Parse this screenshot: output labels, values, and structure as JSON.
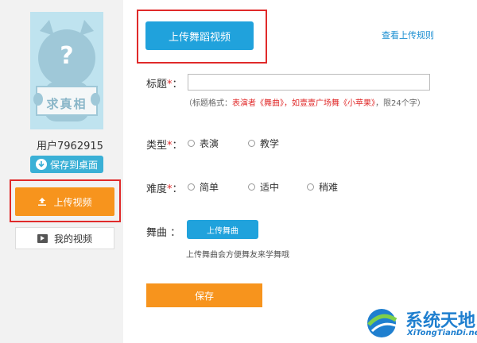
{
  "sidebar": {
    "avatar_caption": "求真相",
    "avatar_mark": "?",
    "username": "用户7962915",
    "save_desktop_label": "保存到桌面",
    "upload_video_label": "上传视频",
    "my_videos_label": "我的视频"
  },
  "main": {
    "upload_dance_label": "上传舞蹈视频",
    "rules_link": "查看上传规则",
    "title_label": "标题",
    "required_mark": "*",
    "colon": "：",
    "title_value": "",
    "hint": {
      "prefix": "（标题格式：",
      "red": "表演者《舞曲》，如壹壹广场舞《小苹果》",
      "suffix": "，限24个字）"
    },
    "type_label": "类型",
    "type_options": [
      "表演",
      "教学"
    ],
    "difficulty_label": "难度",
    "difficulty_options": [
      "简单",
      "适中",
      "稍难"
    ],
    "song_label": "舞曲 ：",
    "upload_song_label": "上传舞曲",
    "song_note": "上传舞曲会方便舞友来学舞哦",
    "save_label": "保存"
  },
  "watermark": {
    "name": "系统天地",
    "url": "XiTongTianDi.net"
  },
  "colors": {
    "sidebar_bg": "#f2f2f2",
    "avatar_bg": "#bfe3ef",
    "primary_blue": "#20a2dc",
    "orange": "#f7941d",
    "highlight_red": "#e02a2a"
  }
}
